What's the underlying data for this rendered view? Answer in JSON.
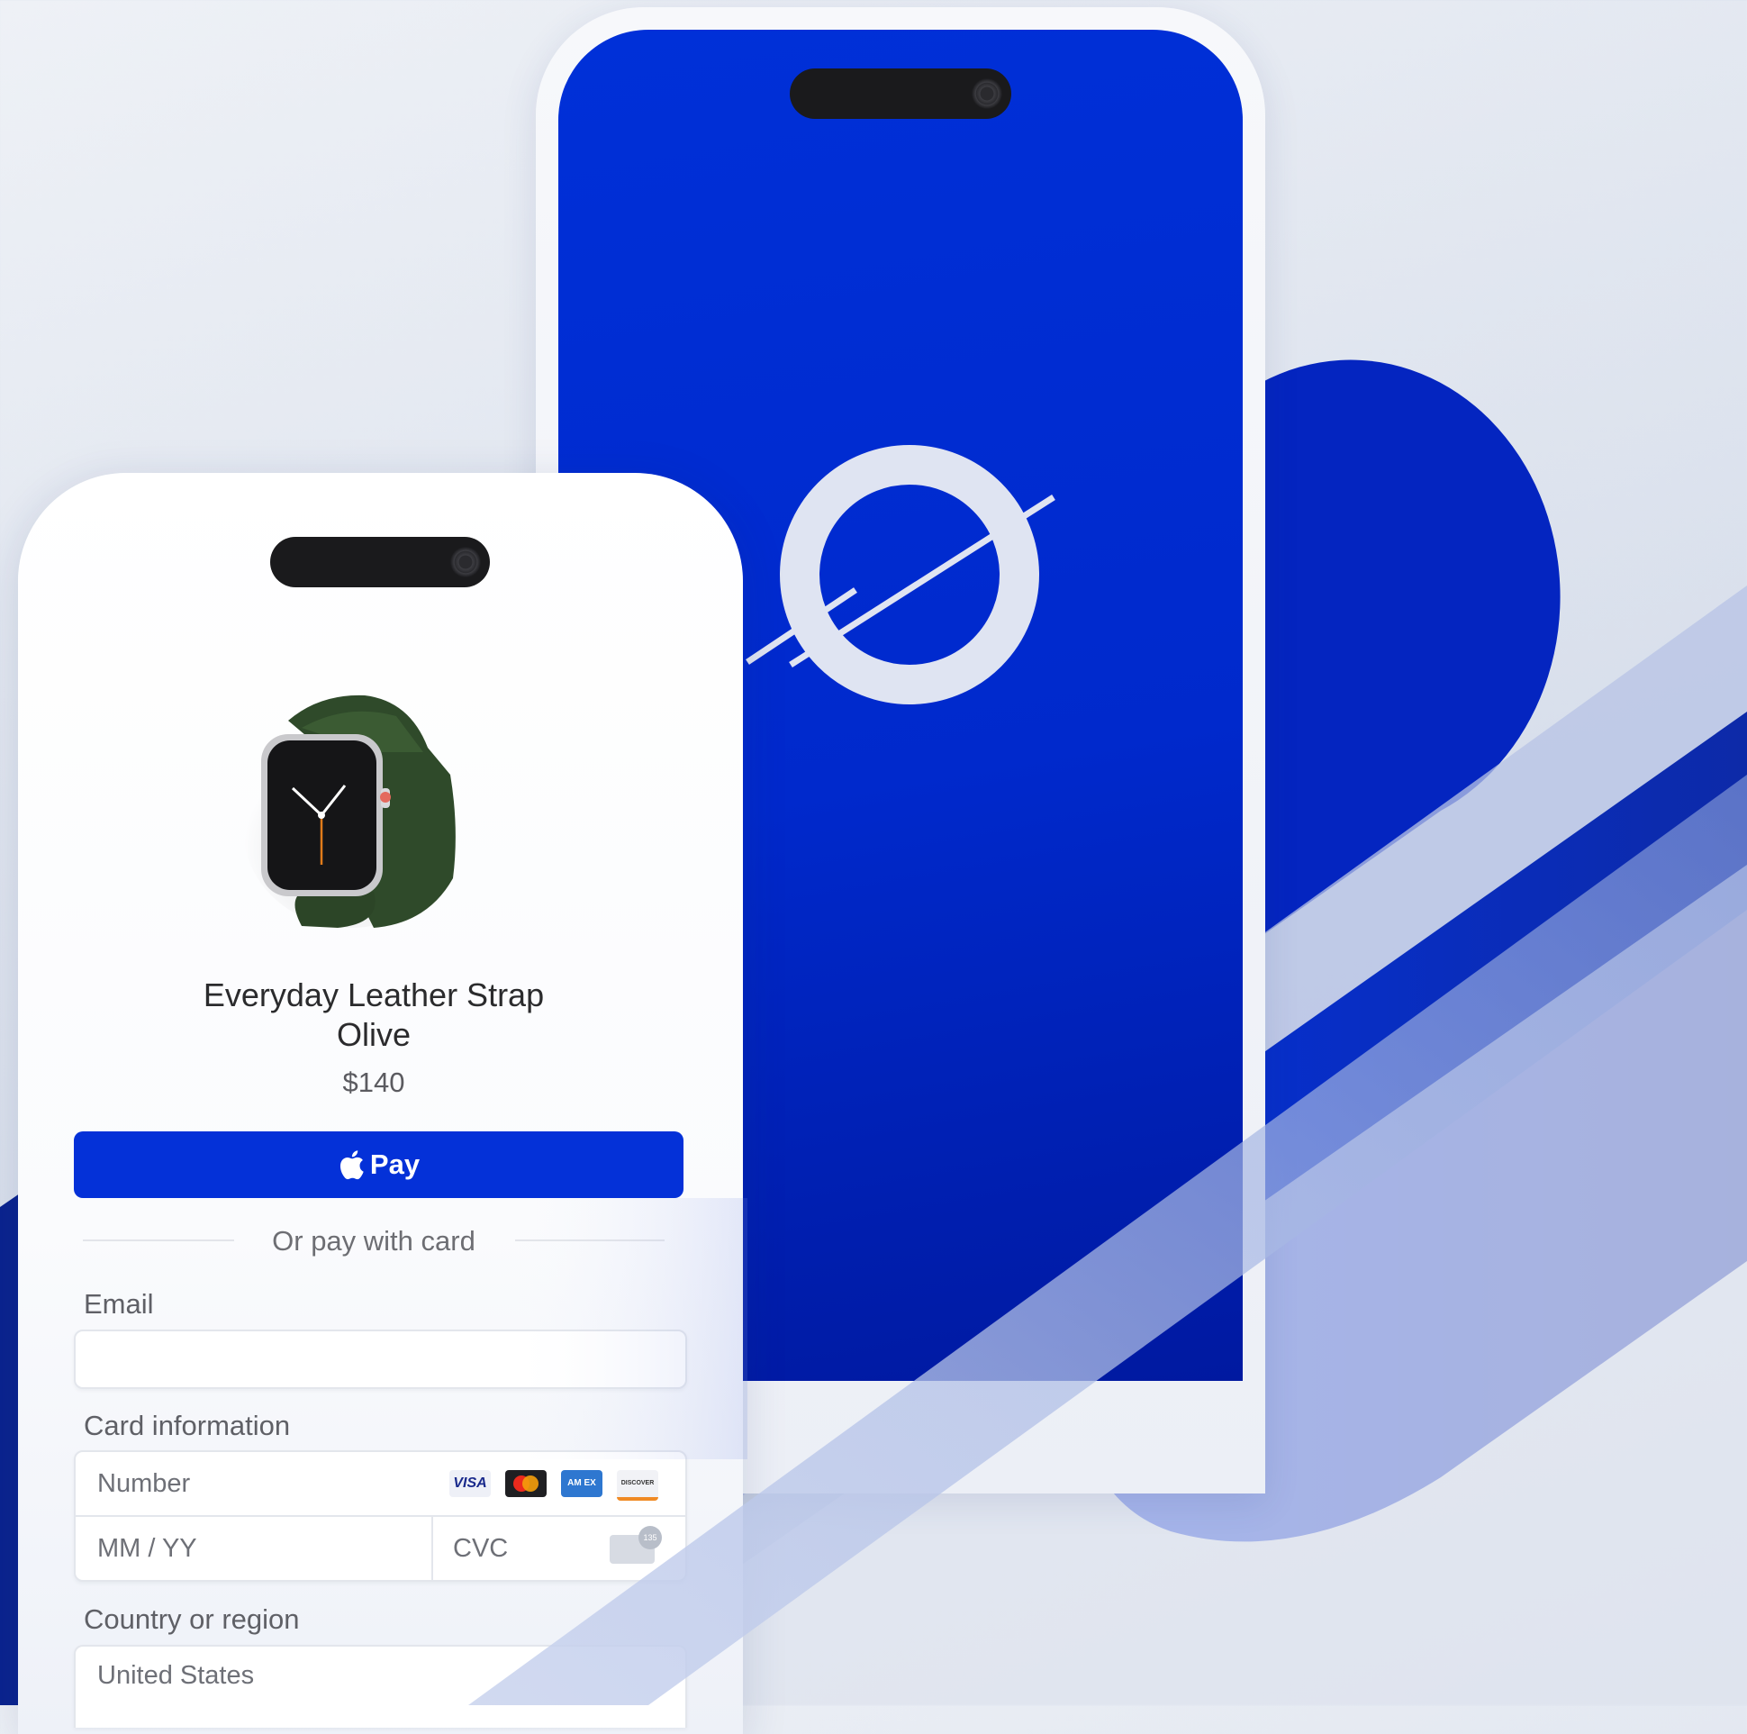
{
  "colors": {
    "brand_blue": "#0431d8",
    "deep_blue": "#0019a0",
    "background": "#eef1f6"
  },
  "product": {
    "title_line1": "Everyday Leather Strap",
    "title_line2": "Olive",
    "price": "$140"
  },
  "checkout": {
    "pay_button_label": "Pay",
    "divider_text": "Or pay with card",
    "email_label": "Email",
    "email_value": "",
    "card_label": "Card information",
    "number_placeholder": "Number",
    "expiry_placeholder": "MM / YY",
    "cvc_placeholder": "CVC",
    "country_label": "Country or region",
    "country_value": "United States"
  },
  "card_brands": [
    {
      "name": "visa-icon",
      "text": "VISA"
    },
    {
      "name": "mastercard-icon",
      "text": ""
    },
    {
      "name": "amex-icon",
      "text": "AM EX"
    },
    {
      "name": "discover-icon",
      "text": "DISCOVER"
    }
  ],
  "cvc_badge_text": "135"
}
